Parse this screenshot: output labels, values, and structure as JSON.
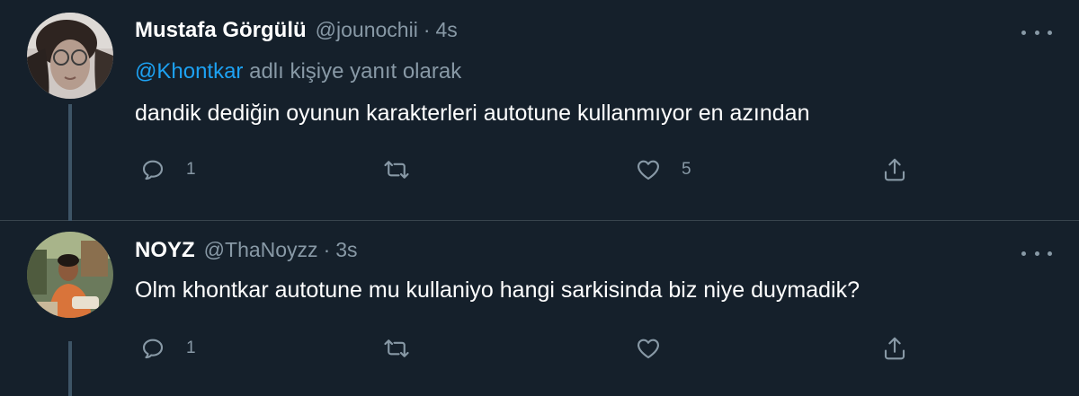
{
  "tweets": [
    {
      "name": "Mustafa Görgülü",
      "handle": "@jounochii",
      "separator": "·",
      "time": "4s",
      "reply_mention": "@Khontkar",
      "reply_suffix": " adlı kişiye yanıt olarak",
      "text": "dandik dediğin oyunun karakterleri autotune kullanmıyor en azından",
      "replies": "1",
      "retweets": "",
      "likes": "5"
    },
    {
      "name": "NOYZ",
      "handle": "@ThaNoyzz",
      "separator": "·",
      "time": "3s",
      "text": "Olm khontkar autotune mu kullaniyo hangi sarkisinda biz niye duymadik?",
      "replies": "1",
      "retweets": "",
      "likes": ""
    }
  ],
  "colors": {
    "background": "#15202b",
    "primary_text": "#ffffff",
    "secondary_text": "#8899a6",
    "link": "#1da1f2",
    "thread_line": "#3d5466"
  },
  "icons": [
    "reply-icon",
    "retweet-icon",
    "like-icon",
    "share-icon",
    "more-icon"
  ]
}
